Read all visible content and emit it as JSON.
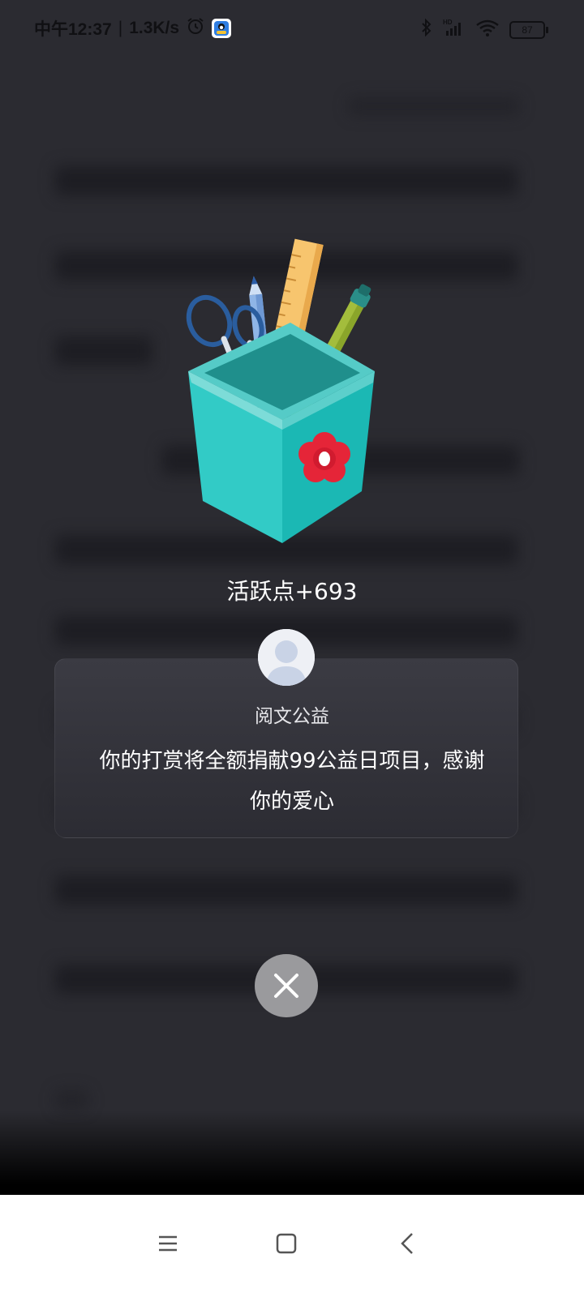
{
  "status_bar": {
    "time": "中午12:37",
    "network_speed": "1.3K/s",
    "battery_level": "87",
    "icons": [
      "alarm-icon",
      "app-notification-icon",
      "bluetooth-icon",
      "hd-signal-icon",
      "wifi-icon",
      "battery-icon"
    ]
  },
  "reward_popup": {
    "points_text": "活跃点+693",
    "source_name": "阅文公益",
    "message": "你的打赏将全额捐献99公益日项目，感谢你的爱心",
    "illustration": "pen-holder-illustration",
    "close_icon": "close-icon"
  },
  "nav_bar": {
    "icons": [
      "menu-icon",
      "home-icon",
      "back-icon"
    ]
  },
  "colors": {
    "overlay_background": "#2b2b31",
    "card_background": "#36363d",
    "close_button": "#9a9a9d",
    "pen_holder": "#1fbdb9",
    "flower": "#e8263c"
  }
}
